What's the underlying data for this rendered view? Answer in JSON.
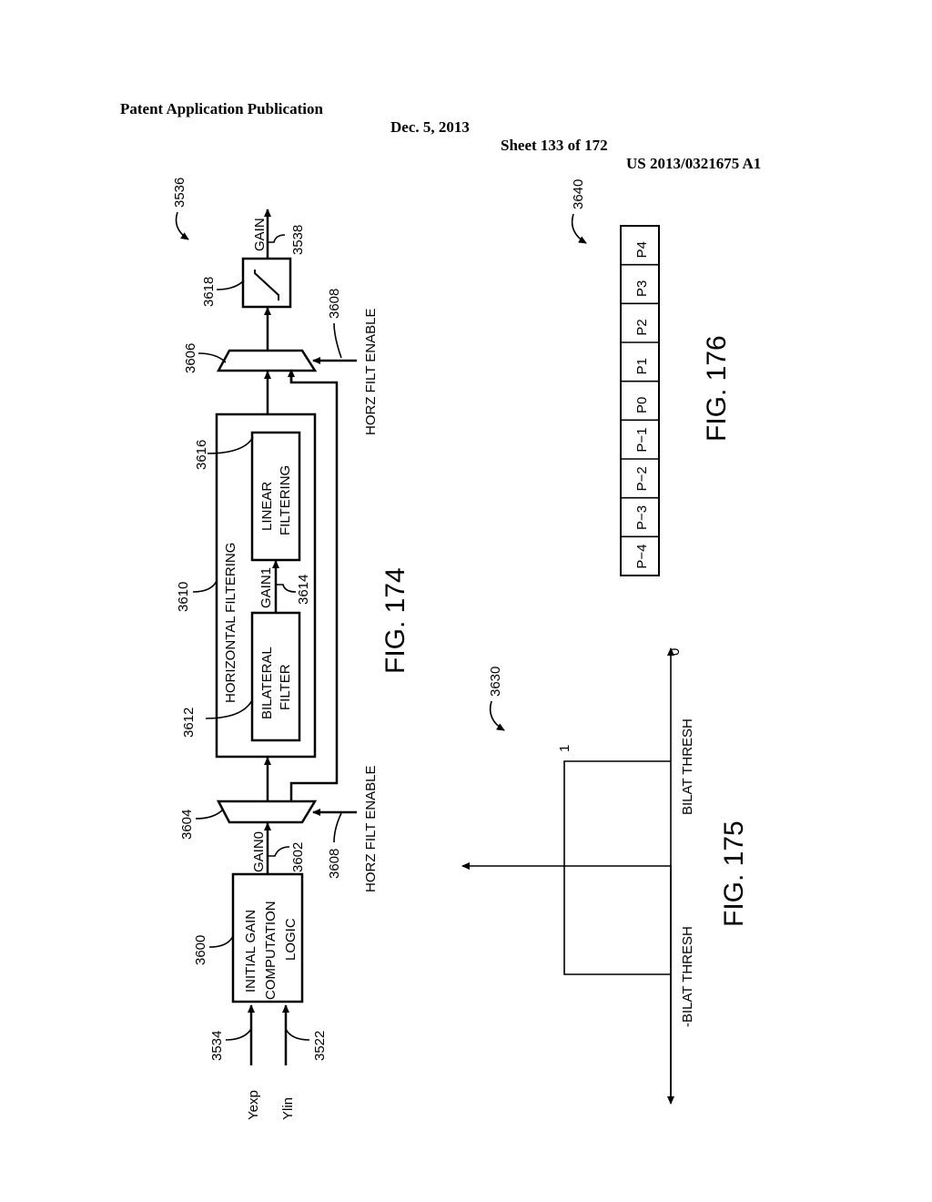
{
  "header": {
    "publication": "Patent Application Publication",
    "date": "Dec. 5, 2013",
    "sheet": "Sheet 133 of 172",
    "number": "US 2013/0321675 A1"
  },
  "fig174": {
    "title": "FIG. 174",
    "ref_overall": "3536",
    "inputs": [
      {
        "label": "Yexp",
        "ref": "3534"
      },
      {
        "label": "Ylin",
        "ref": "3522"
      }
    ],
    "initial_gain_block": {
      "lines": [
        "INITIAL GAIN",
        "COMPUTATION",
        "LOGIC"
      ],
      "ref": "3600"
    },
    "gain0": {
      "label": "GAIN0",
      "ref": "3602"
    },
    "mux1_ref": "3604",
    "enable1": {
      "label": "HORZ FILT ENABLE",
      "ref": "3608"
    },
    "horizontal_filtering": {
      "label": "HORIZONTAL FILTERING",
      "ref": "3610"
    },
    "bilateral": {
      "lines": [
        "BILATERAL",
        "FILTER"
      ],
      "ref": "3612"
    },
    "gain1": {
      "label": "GAIN1",
      "ref": "3614"
    },
    "linear": {
      "lines": [
        "LINEAR",
        "FILTERING"
      ],
      "ref": "3616"
    },
    "mux2_ref": "3606",
    "enable2": {
      "label": "HORZ FILT ENABLE",
      "ref": "3608"
    },
    "clip_ref": "3618",
    "output": {
      "label": "GAIN",
      "ref": "3538"
    }
  },
  "fig175": {
    "title": "FIG. 175",
    "ref": "3630",
    "y_value_label": "1",
    "axis_end_label": "0",
    "neg_thresh": "-BILAT THRESH",
    "pos_thresh": "BILAT THRESH"
  },
  "fig176": {
    "title": "FIG. 176",
    "ref": "3640",
    "pixels": [
      "P−4",
      "P−3",
      "P−2",
      "P−1",
      "P0",
      "P1",
      "P2",
      "P3",
      "P4"
    ]
  }
}
